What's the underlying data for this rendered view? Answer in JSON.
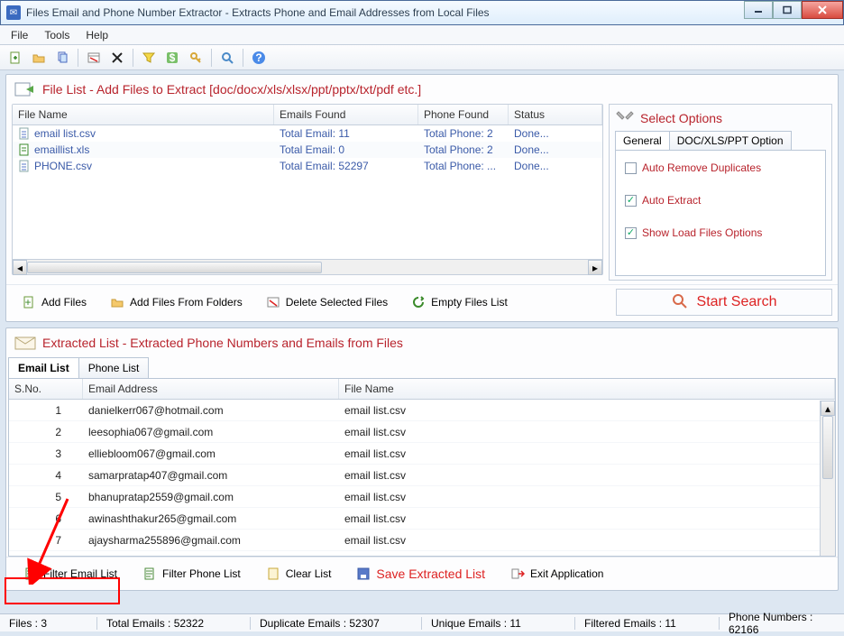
{
  "window": {
    "title": "Files Email and Phone Number Extractor  -  Extracts Phone and Email Addresses from Local Files"
  },
  "menu": {
    "file": "File",
    "tools": "Tools",
    "help": "Help"
  },
  "panels": {
    "filelist_title": "File List - Add Files to Extract  [doc/docx/xls/xlsx/ppt/pptx/txt/pdf etc.]",
    "extracted_title": "Extracted List - Extracted Phone Numbers and Emails from Files",
    "options_title": "Select Options"
  },
  "file_table": {
    "headers": {
      "name": "File Name",
      "emails": "Emails Found",
      "phone": "Phone Found",
      "status": "Status"
    },
    "rows": [
      {
        "name": "email list.csv",
        "emails": "Total Email: 11",
        "phone": "Total Phone: 2",
        "status": "Done..."
      },
      {
        "name": "emaillist.xls",
        "emails": "Total Email: 0",
        "phone": "Total Phone: 2",
        "status": "Done..."
      },
      {
        "name": "PHONE.csv",
        "emails": "Total Email: 52297",
        "phone": "Total Phone: ...",
        "status": "Done..."
      }
    ]
  },
  "file_actions": {
    "add_files": "Add Files",
    "add_folders": "Add Files From Folders",
    "delete_selected": "Delete Selected Files",
    "empty_list": "Empty Files List",
    "start_search": "Start Search"
  },
  "options": {
    "tab_general": "General",
    "tab_docxls": "DOC/XLS/PPT Option",
    "auto_remove_dup": "Auto Remove Duplicates",
    "auto_extract": "Auto Extract",
    "show_load": "Show Load Files Options"
  },
  "extracted": {
    "tab_email": "Email List",
    "tab_phone": "Phone List",
    "headers": {
      "sno": "S.No.",
      "email": "Email Address",
      "file": "File Name"
    },
    "rows": [
      {
        "sno": "1",
        "email": "danielkerr067@hotmail.com",
        "file": "email list.csv"
      },
      {
        "sno": "2",
        "email": "leesophia067@gmail.com",
        "file": "email list.csv"
      },
      {
        "sno": "3",
        "email": "elliebloom067@gmail.com",
        "file": "email list.csv"
      },
      {
        "sno": "4",
        "email": "samarpratap407@gmail.com",
        "file": "email list.csv"
      },
      {
        "sno": "5",
        "email": "bhanupratap2559@gmail.com",
        "file": "email list.csv"
      },
      {
        "sno": "6",
        "email": "awinashthakur265@gmail.com",
        "file": "email list.csv"
      },
      {
        "sno": "7",
        "email": "ajaysharma255896@gmail.com",
        "file": "email list.csv"
      }
    ]
  },
  "bottom": {
    "filter_email": "Filter Email List",
    "filter_phone": "Filter Phone List",
    "clear_list": "Clear List",
    "save_list": "Save Extracted List",
    "exit_app": "Exit Application"
  },
  "status": {
    "files": "Files :  3",
    "total_emails": "Total Emails :  52322",
    "dup_emails": "Duplicate Emails :  52307",
    "unique_emails": "Unique Emails :  11",
    "filtered_emails": "Filtered Emails :  11",
    "phone_numbers": "Phone Numbers :  62166"
  }
}
